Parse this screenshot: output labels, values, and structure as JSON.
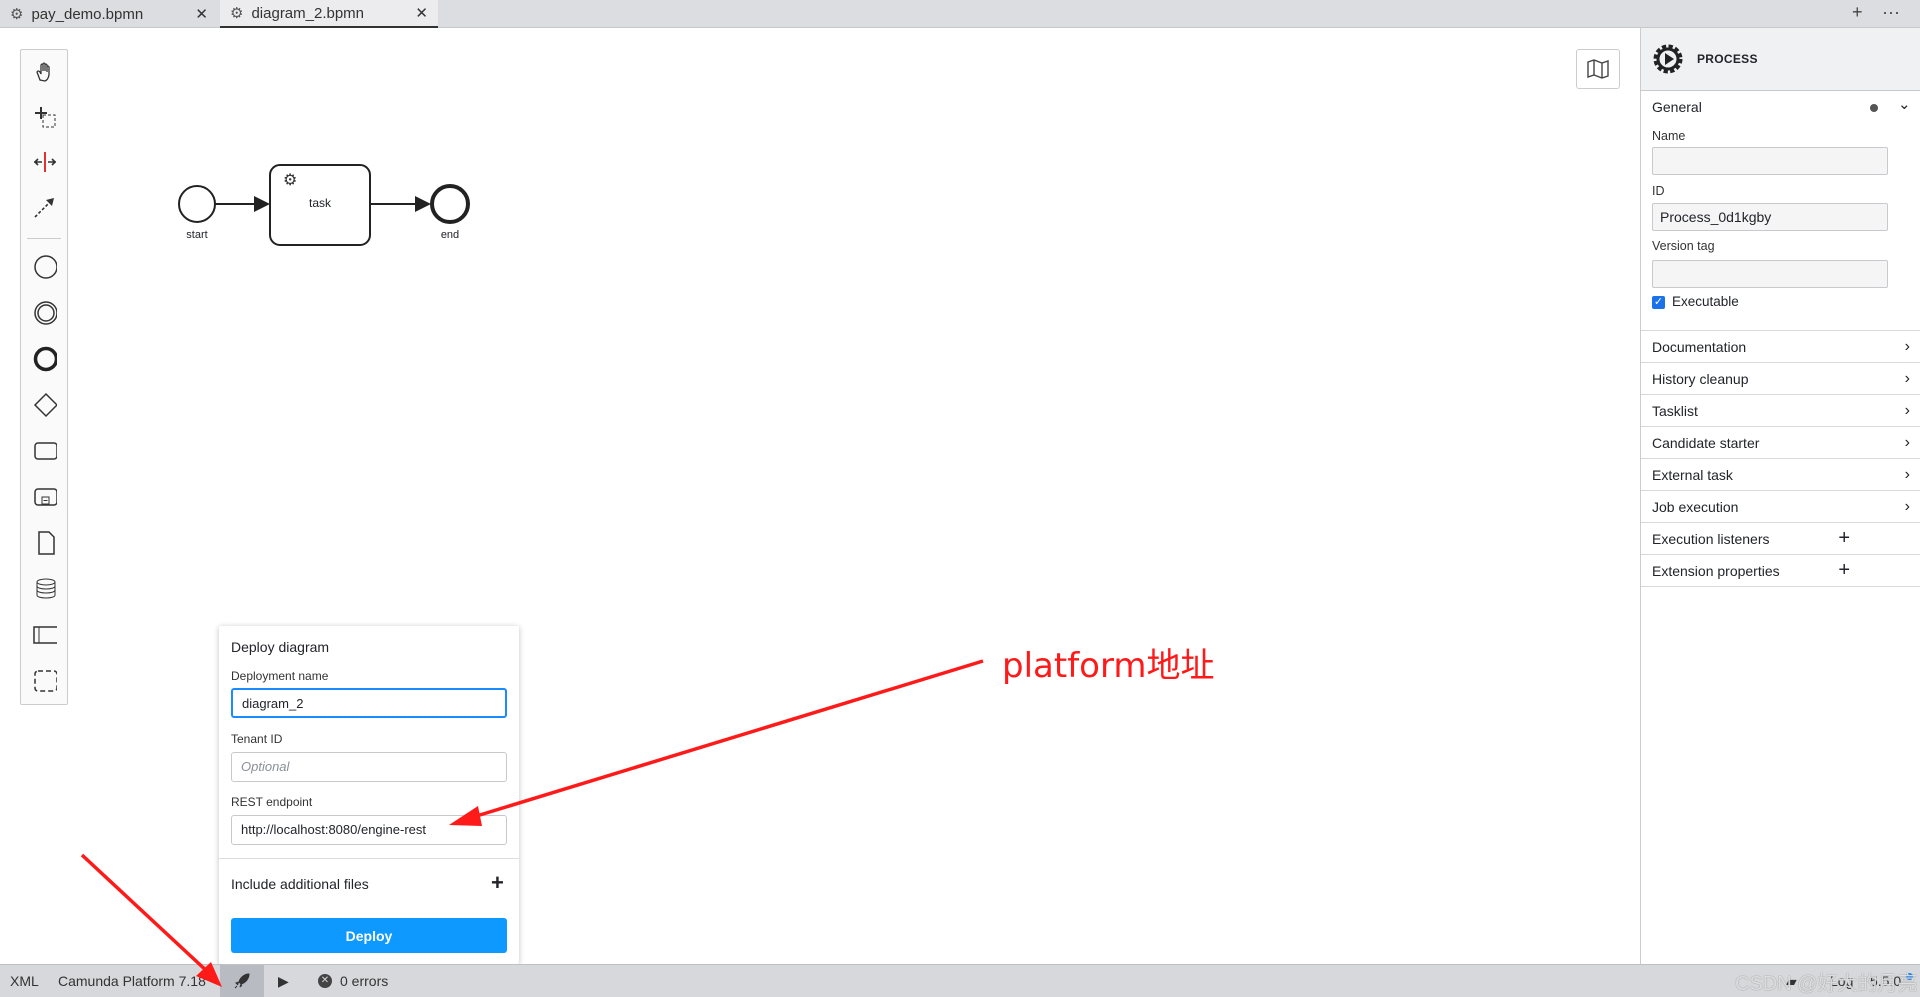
{
  "tabs": [
    {
      "label": "pay_demo.bpmn",
      "icon": "gear-icon"
    },
    {
      "label": "diagram_2.bpmn",
      "icon": "gear-icon",
      "active": true
    }
  ],
  "tabbar": {
    "add": "+",
    "more": "···"
  },
  "diagram": {
    "start_label": "start",
    "task_label": "task",
    "end_label": "end"
  },
  "panel": {
    "header": "PROCESS",
    "general": "General",
    "name_label": "Name",
    "name_value": "",
    "id_label": "ID",
    "id_value": "Process_0d1kgby",
    "version_label": "Version tag",
    "version_value": "",
    "executable_label": "Executable",
    "executable_checked": true,
    "groups": [
      {
        "label": "Documentation",
        "icon": "chevron-right-icon"
      },
      {
        "label": "History cleanup",
        "icon": "chevron-right-icon"
      },
      {
        "label": "Tasklist",
        "icon": "chevron-right-icon"
      },
      {
        "label": "Candidate starter",
        "icon": "chevron-right-icon"
      },
      {
        "label": "External task",
        "icon": "chevron-right-icon"
      },
      {
        "label": "Job execution",
        "icon": "chevron-right-icon"
      },
      {
        "label": "Execution listeners",
        "icon": "plus-icon"
      },
      {
        "label": "Extension properties",
        "icon": "plus-icon"
      }
    ]
  },
  "deploy": {
    "title": "Deploy diagram",
    "name_label": "Deployment name",
    "name_value": "diagram_2",
    "tenant_label": "Tenant ID",
    "tenant_placeholder": "Optional",
    "endpoint_label": "REST endpoint",
    "endpoint_value": "http://localhost:8080/engine-rest",
    "additional": "Include additional files",
    "button": "Deploy",
    "accent": "#0d99ff"
  },
  "statusbar": {
    "xml": "XML",
    "platform": "Camunda Platform 7.18",
    "errors": "0 errors",
    "log": "Log",
    "version": "5.5.0"
  },
  "annotation": {
    "text": "platform地址",
    "color": "#ff1a1a"
  },
  "watermark": "CSDN @好大的月亮"
}
